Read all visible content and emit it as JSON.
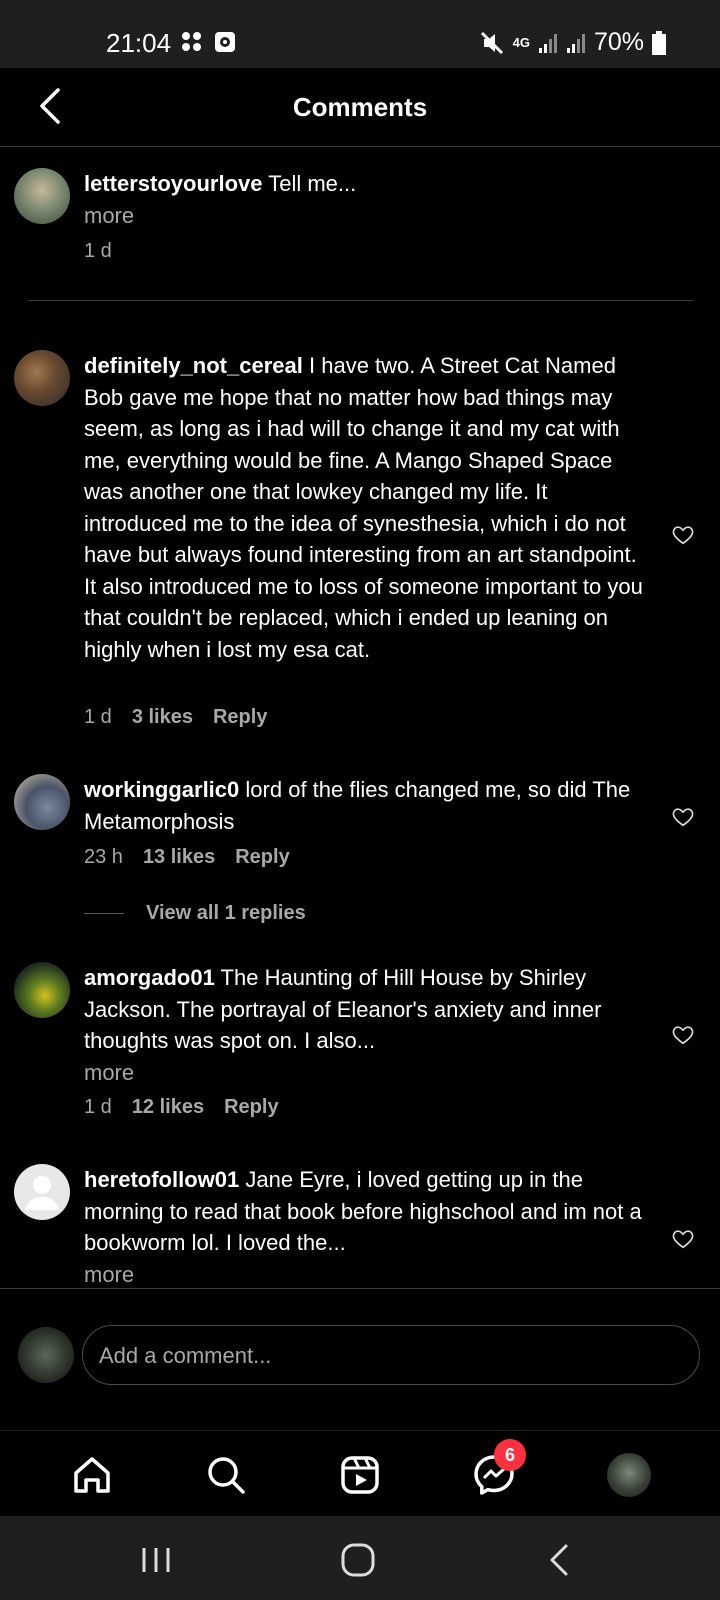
{
  "status": {
    "time": "21:04",
    "network": "4G",
    "battery": "70%"
  },
  "header": {
    "title": "Comments"
  },
  "comments": [
    {
      "username": "letterstoyourlove",
      "text": "Tell me...",
      "more": "more",
      "time": "1 d"
    },
    {
      "username": "definitely_not_cereal",
      "text": "I have two. A Street Cat Named Bob gave me hope that no matter how bad things may seem, as long as i had will to change it and my cat with me, everything would be fine. A Mango Shaped Space was another one that lowkey changed my life. It introduced me to the idea of synesthesia, which i do not have but always found interesting from an art standpoint. It also introduced me to loss of someone important to you that couldn't be replaced, which i ended up leaning on highly when i lost my esa cat.",
      "time": "1 d",
      "likes": "3 likes",
      "reply": "Reply"
    },
    {
      "username": "workinggarlic0",
      "text": "lord of the flies changed me, so did The Metamorphosis",
      "time": "23 h",
      "likes": "13 likes",
      "reply": "Reply"
    },
    {
      "username": "amorgado01",
      "text": "The Haunting of Hill House by Shirley Jackson. The portrayal of Eleanor's anxiety and inner thoughts was spot on. I also...",
      "more": "more",
      "time": "1 d",
      "likes": "12 likes",
      "reply": "Reply"
    },
    {
      "username": "heretofollow01",
      "text": "Jane Eyre, i loved getting up in the morning to read that book before highschool and im not a bookworm lol. I loved the...",
      "more": "more"
    }
  ],
  "view_replies": "View all 1 replies",
  "composer": {
    "placeholder": "Add a comment..."
  },
  "tabbar": {
    "messages_badge": "6"
  }
}
